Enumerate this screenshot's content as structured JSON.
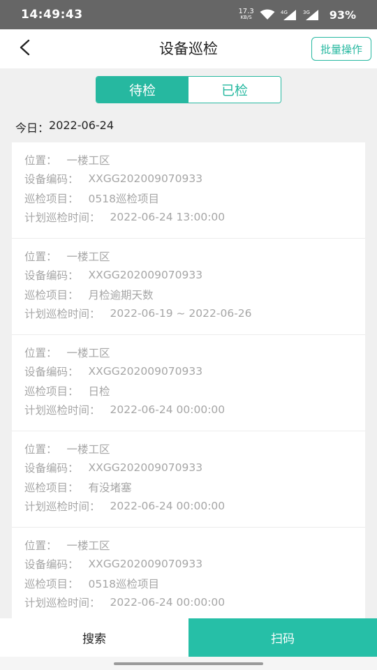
{
  "status_bar": {
    "time": "14:49:43",
    "net_speed_value": "17.3",
    "net_speed_unit": "KB/S",
    "signal1_label": "4G",
    "signal2_label": "3G",
    "battery": "93%",
    "icons": [
      "wifi-icon",
      "signal-icon",
      "signal-icon"
    ]
  },
  "header": {
    "title": "设备巡检",
    "back_icon": "chevron-left-icon",
    "batch_label": "批量操作"
  },
  "tabs": [
    {
      "label": "待检",
      "active": true
    },
    {
      "label": "已检",
      "active": false
    }
  ],
  "today": {
    "label": "今日：",
    "date": "2022-06-24"
  },
  "labels": {
    "location": "位置：",
    "code": "设备编码：",
    "item": "巡检项目：",
    "time": "计划巡检时间："
  },
  "items": [
    {
      "location": "一楼工区",
      "code": "XXGG202009070933",
      "item": "0518巡检项目",
      "time": "2022-06-24 13:00:00"
    },
    {
      "location": "一楼工区",
      "code": "XXGG202009070933",
      "item": "月检逾期天数",
      "time": "2022-06-19 ~ 2022-06-26"
    },
    {
      "location": "一楼工区",
      "code": "XXGG202009070933",
      "item": "日检",
      "time": "2022-06-24 00:00:00"
    },
    {
      "location": "一楼工区",
      "code": "XXGG202009070933",
      "item": "有没堵塞",
      "time": "2022-06-24 00:00:00"
    },
    {
      "location": "一楼工区",
      "code": "XXGG202009070933",
      "item": "0518巡检项目",
      "time": "2022-06-24 00:00:00"
    }
  ],
  "bottom": {
    "search_label": "搜索",
    "scan_label": "扫码"
  },
  "colors": {
    "accent": "#26b8a0",
    "status_bar": "#666666",
    "secondary_text": "#a6a6a6"
  }
}
